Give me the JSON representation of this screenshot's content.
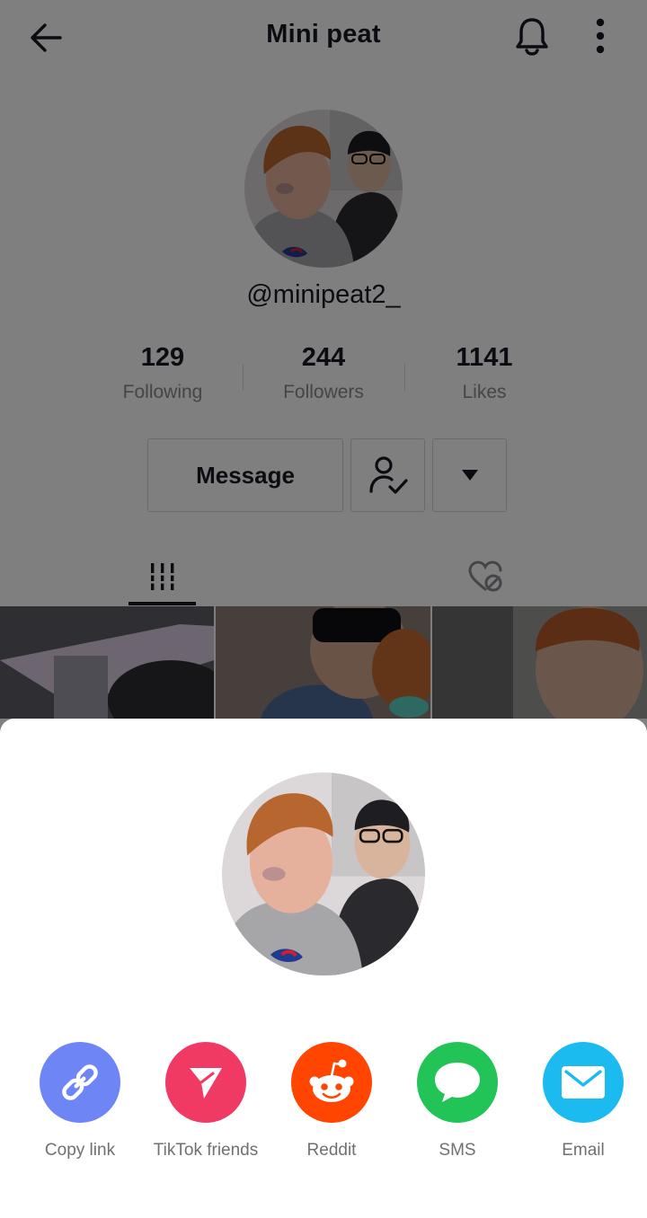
{
  "header": {
    "title": "Mini peat",
    "back_icon": "arrow-left-icon",
    "bell_icon": "bell-icon",
    "more_icon": "more-vertical-icon"
  },
  "profile": {
    "handle": "@minipeat2_",
    "stats": [
      {
        "value": "129",
        "label": "Following"
      },
      {
        "value": "244",
        "label": "Followers"
      },
      {
        "value": "1141",
        "label": "Likes"
      }
    ],
    "buttons": {
      "message_label": "Message",
      "follow_icon": "user-check-icon",
      "dropdown_icon": "caret-down-icon"
    },
    "tabs": [
      {
        "icon": "grid-icon",
        "selected": true
      },
      {
        "icon": "hidden-heart-icon",
        "selected": false
      }
    ]
  },
  "share_sheet": {
    "options": [
      {
        "label": "Copy link",
        "icon": "link-icon",
        "color": "#6e85f5"
      },
      {
        "label": "TikTok friends",
        "icon": "send-arrow-icon",
        "color": "#f13a63"
      },
      {
        "label": "Reddit",
        "icon": "reddit-icon",
        "color": "#ff4500"
      },
      {
        "label": "SMS",
        "icon": "chat-bubble-icon",
        "color": "#22c457"
      },
      {
        "label": "Email",
        "icon": "mail-icon",
        "color": "#1cbbef"
      }
    ]
  },
  "colors": {
    "text_primary": "#161823",
    "text_secondary": "#8a8b91",
    "overlay": "rgba(0,0,0,0.5)"
  }
}
